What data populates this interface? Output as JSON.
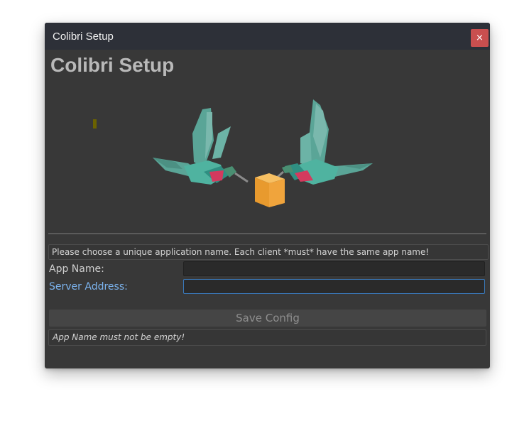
{
  "window": {
    "title": "Colibri Setup",
    "close_symbol": "×"
  },
  "header": {
    "heading": "Colibri Setup"
  },
  "banner": {
    "image": "two-hummingbirds-carrying-box",
    "colors": {
      "bird_body": "#4fb3a0",
      "bird_accent": "#d43a5e",
      "box": "#f0a43c"
    }
  },
  "form": {
    "help_text": "Please choose a unique application name. Each client *must* have the same app name!",
    "app_name": {
      "label": "App Name:",
      "value": ""
    },
    "server_address": {
      "label": "Server Address:",
      "value": ""
    },
    "save_label": "Save Config",
    "error_text": "App Name must not be empty!"
  },
  "colors": {
    "window_bg": "#383838",
    "titlebar_bg": "#2d3038",
    "close_button": "#c94f4f",
    "focus_accent": "#7cb4ef"
  }
}
